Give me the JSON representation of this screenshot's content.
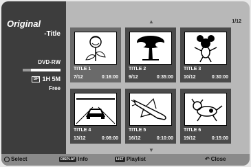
{
  "sidebar": {
    "title": "Original",
    "subtitle": "-Title",
    "disc_type": "DVD-RW",
    "disc_usage_fraction": 0.22,
    "mode_badge": "SP",
    "time_free": "1H 5M",
    "free_label": "Free"
  },
  "page_indicator": "1/12",
  "titles": [
    {
      "label": "TITLE  1",
      "date": "7/12",
      "duration": "0:16:00",
      "thumbnail": "flower-icon"
    },
    {
      "label": "TITLE  2",
      "date": "9/12",
      "duration": "0:35:00",
      "thumbnail": "tree-icon"
    },
    {
      "label": "TITLE  3",
      "date": "10/12",
      "duration": "0:30:00",
      "thumbnail": "cartoon-character-icon"
    },
    {
      "label": "TITLE  4",
      "date": "13/12",
      "duration": "0:08:00",
      "thumbnail": "car-icon"
    },
    {
      "label": "TITLE  5",
      "date": "16/12",
      "duration": "0:10:00",
      "thumbnail": "space-shuttle-icon"
    },
    {
      "label": "TITLE  6",
      "date": "19/12",
      "duration": "0:15:00",
      "thumbnail": "dog-icon"
    }
  ],
  "footer": {
    "select_label": "Select",
    "display_button": "DISPLAY",
    "info_label": "Info",
    "list_button": "LIST",
    "playlist_label": "Playlist",
    "close_label": "Close"
  }
}
